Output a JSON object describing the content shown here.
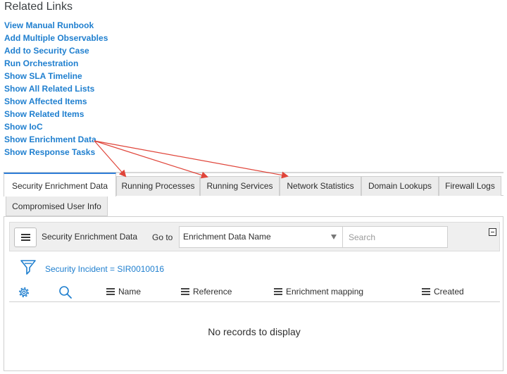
{
  "related_links": {
    "title": "Related Links",
    "items": [
      "View Manual Runbook",
      "Add Multiple Observables",
      "Add to Security Case",
      "Run Orchestration",
      "Show SLA Timeline",
      "Show All Related Lists",
      "Show Affected Items",
      "Show Related Items",
      "Show IoC",
      "Show Enrichment Data",
      "Show Response Tasks"
    ]
  },
  "tabs": [
    "Security Enrichment Data",
    "Running Processes",
    "Running Services",
    "Network Statistics",
    "Domain Lookups",
    "Firewall Logs",
    "Compromised User Info"
  ],
  "list": {
    "title": "Security Enrichment Data",
    "goto_label": "Go to",
    "goto_selected": "Enrichment Data Name",
    "search_placeholder": "Search",
    "filter_breadcrumb": "Security Incident = SIR0010016",
    "columns": [
      "Name",
      "Reference",
      "Enrichment mapping",
      "Created"
    ],
    "empty_message": "No records to display"
  },
  "colors": {
    "link": "#1f7fcf",
    "active_tab_border": "#2f7ed8",
    "annotation_arrow": "#e0453a"
  },
  "icons": [
    "hamburger-menu-icon",
    "chevron-down-icon",
    "collapse-icon",
    "funnel-filter-icon",
    "gear-icon",
    "search-icon",
    "column-menu-icon"
  ]
}
